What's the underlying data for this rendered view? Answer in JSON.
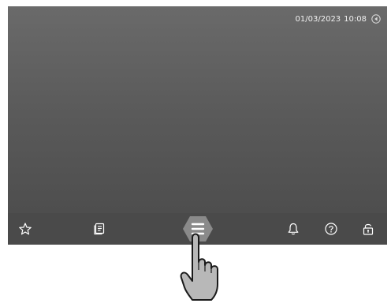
{
  "status_bar": {
    "date": "01/03/2023",
    "time": "10:08",
    "network_icon": "network-icon"
  },
  "bottom_bar": {
    "buttons": [
      {
        "name": "favorites-button",
        "icon": "star-icon"
      },
      {
        "name": "notes-button",
        "icon": "notes-icon"
      },
      {
        "name": "main-menu-button",
        "icon": "menu-icon"
      },
      {
        "name": "notifications-button",
        "icon": "bell-icon"
      },
      {
        "name": "help-button",
        "icon": "help-icon"
      },
      {
        "name": "lock-button",
        "icon": "lock-icon"
      }
    ]
  },
  "colors": {
    "screen_top": "#6a6a6a",
    "screen_bottom": "#4a4a4a",
    "bar": "#4a4a4a",
    "menu_highlight": "#8a8a8a",
    "hand_fill": "#b8b8b8",
    "icon": "#ffffff"
  }
}
